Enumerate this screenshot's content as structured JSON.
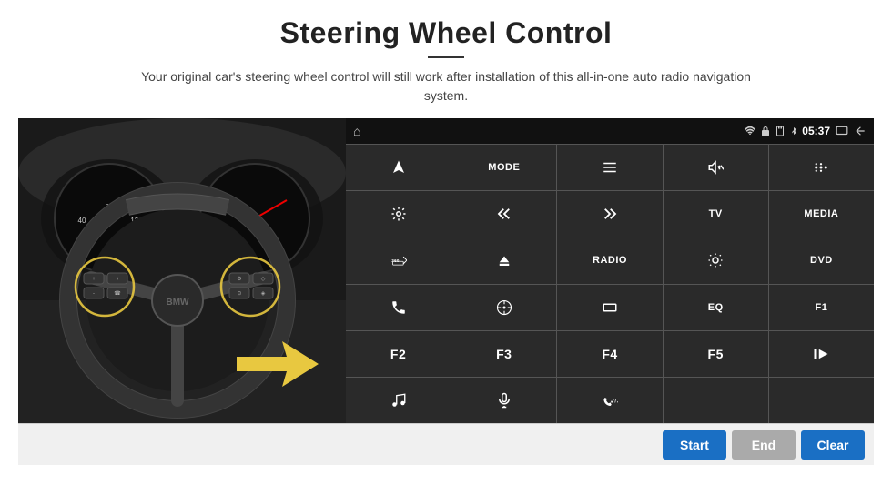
{
  "header": {
    "title": "Steering Wheel Control",
    "divider": true,
    "subtitle": "Your original car's steering wheel control will still work after installation of this all-in-one auto radio navigation system."
  },
  "android_ui": {
    "status_bar": {
      "home_icon": "⌂",
      "wifi_icon": "wifi",
      "lock_icon": "🔒",
      "sd_icon": "SD",
      "bt_icon": "BT",
      "time": "05:37",
      "screen_icon": "▭",
      "back_icon": "↩"
    },
    "buttons": [
      {
        "id": "nav",
        "label": "",
        "icon": "nav",
        "row": 1,
        "col": 1
      },
      {
        "id": "mode",
        "label": "MODE",
        "row": 1,
        "col": 2
      },
      {
        "id": "list",
        "label": "",
        "icon": "list",
        "row": 1,
        "col": 3
      },
      {
        "id": "mute",
        "label": "",
        "icon": "mute",
        "row": 1,
        "col": 4
      },
      {
        "id": "dots",
        "label": "",
        "icon": "dots",
        "row": 1,
        "col": 5
      },
      {
        "id": "settings",
        "label": "",
        "icon": "gear",
        "row": 2,
        "col": 1
      },
      {
        "id": "prev",
        "label": "",
        "icon": "prev",
        "row": 2,
        "col": 2
      },
      {
        "id": "next",
        "label": "",
        "icon": "next",
        "row": 2,
        "col": 3
      },
      {
        "id": "tv",
        "label": "TV",
        "row": 2,
        "col": 4
      },
      {
        "id": "media",
        "label": "MEDIA",
        "row": 2,
        "col": 5
      },
      {
        "id": "360cam",
        "label": "",
        "icon": "360",
        "row": 3,
        "col": 1
      },
      {
        "id": "eject",
        "label": "",
        "icon": "eject",
        "row": 3,
        "col": 2
      },
      {
        "id": "radio",
        "label": "RADIO",
        "row": 3,
        "col": 3
      },
      {
        "id": "brightness",
        "label": "",
        "icon": "sun",
        "row": 3,
        "col": 4
      },
      {
        "id": "dvd",
        "label": "DVD",
        "row": 3,
        "col": 5
      },
      {
        "id": "phone",
        "label": "",
        "icon": "phone",
        "row": 4,
        "col": 1
      },
      {
        "id": "navi",
        "label": "",
        "icon": "navi",
        "row": 4,
        "col": 2
      },
      {
        "id": "rect",
        "label": "",
        "icon": "rect",
        "row": 4,
        "col": 3
      },
      {
        "id": "eq",
        "label": "EQ",
        "row": 4,
        "col": 4
      },
      {
        "id": "f1",
        "label": "F1",
        "row": 4,
        "col": 5
      },
      {
        "id": "f2",
        "label": "F2",
        "row": 5,
        "col": 1
      },
      {
        "id": "f3",
        "label": "F3",
        "row": 5,
        "col": 2
      },
      {
        "id": "f4",
        "label": "F4",
        "row": 5,
        "col": 3
      },
      {
        "id": "f5",
        "label": "F5",
        "row": 5,
        "col": 4
      },
      {
        "id": "playpause",
        "label": "",
        "icon": "playpause",
        "row": 5,
        "col": 5
      },
      {
        "id": "music",
        "label": "",
        "icon": "music",
        "row": 6,
        "col": 1
      },
      {
        "id": "mic",
        "label": "",
        "icon": "mic",
        "row": 6,
        "col": 2
      },
      {
        "id": "volphone",
        "label": "",
        "icon": "volphone",
        "row": 6,
        "col": 3
      }
    ]
  },
  "bottom_bar": {
    "start_label": "Start",
    "end_label": "End",
    "clear_label": "Clear"
  },
  "colors": {
    "accent": "#1a6fc4",
    "bg_dark": "#2a2a2a",
    "bg_status": "#111",
    "grid_gap": "#555",
    "bottom_bg": "#f0f0f0",
    "btn_disabled": "#aaa"
  }
}
